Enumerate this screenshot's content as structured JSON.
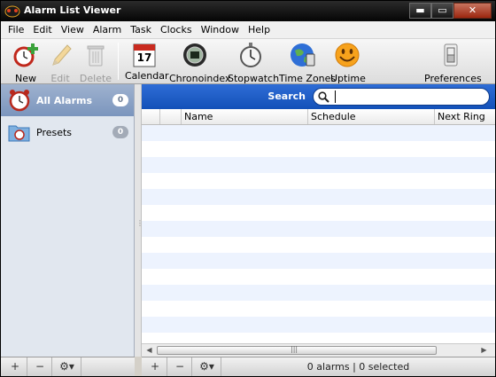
{
  "window": {
    "title": "Alarm List Viewer",
    "minimize": "▬",
    "maximize": "▭",
    "close": "✕"
  },
  "menu": [
    "File",
    "Edit",
    "View",
    "Alarm",
    "Task",
    "Clocks",
    "Window",
    "Help"
  ],
  "toolbar": {
    "new": "New",
    "edit": "Edit",
    "delete": "Delete",
    "calendar": "Calendar",
    "calendar_day": "17",
    "chronoindex": "Chronoindex",
    "stopwatch": "Stopwatch",
    "timezones": "Time Zones",
    "uptime": "Uptime",
    "preferences": "Preferences"
  },
  "sidebar": {
    "items": [
      {
        "label": "All Alarms",
        "count": "0",
        "selected": true
      },
      {
        "label": "Presets",
        "count": "0",
        "selected": false
      }
    ]
  },
  "search": {
    "label": "Search",
    "value": "",
    "placeholder": ""
  },
  "table": {
    "columns": [
      "",
      "Name",
      "Schedule",
      "Next Ring"
    ]
  },
  "bottombar": {
    "add": "+",
    "remove": "−",
    "action": "⚙▾"
  },
  "status": {
    "text": "0 alarms | 0 selected"
  },
  "colors": {
    "accent": "#1f5fc8",
    "selection": "#8aa0c6",
    "row_alt": "#edf3fe"
  }
}
